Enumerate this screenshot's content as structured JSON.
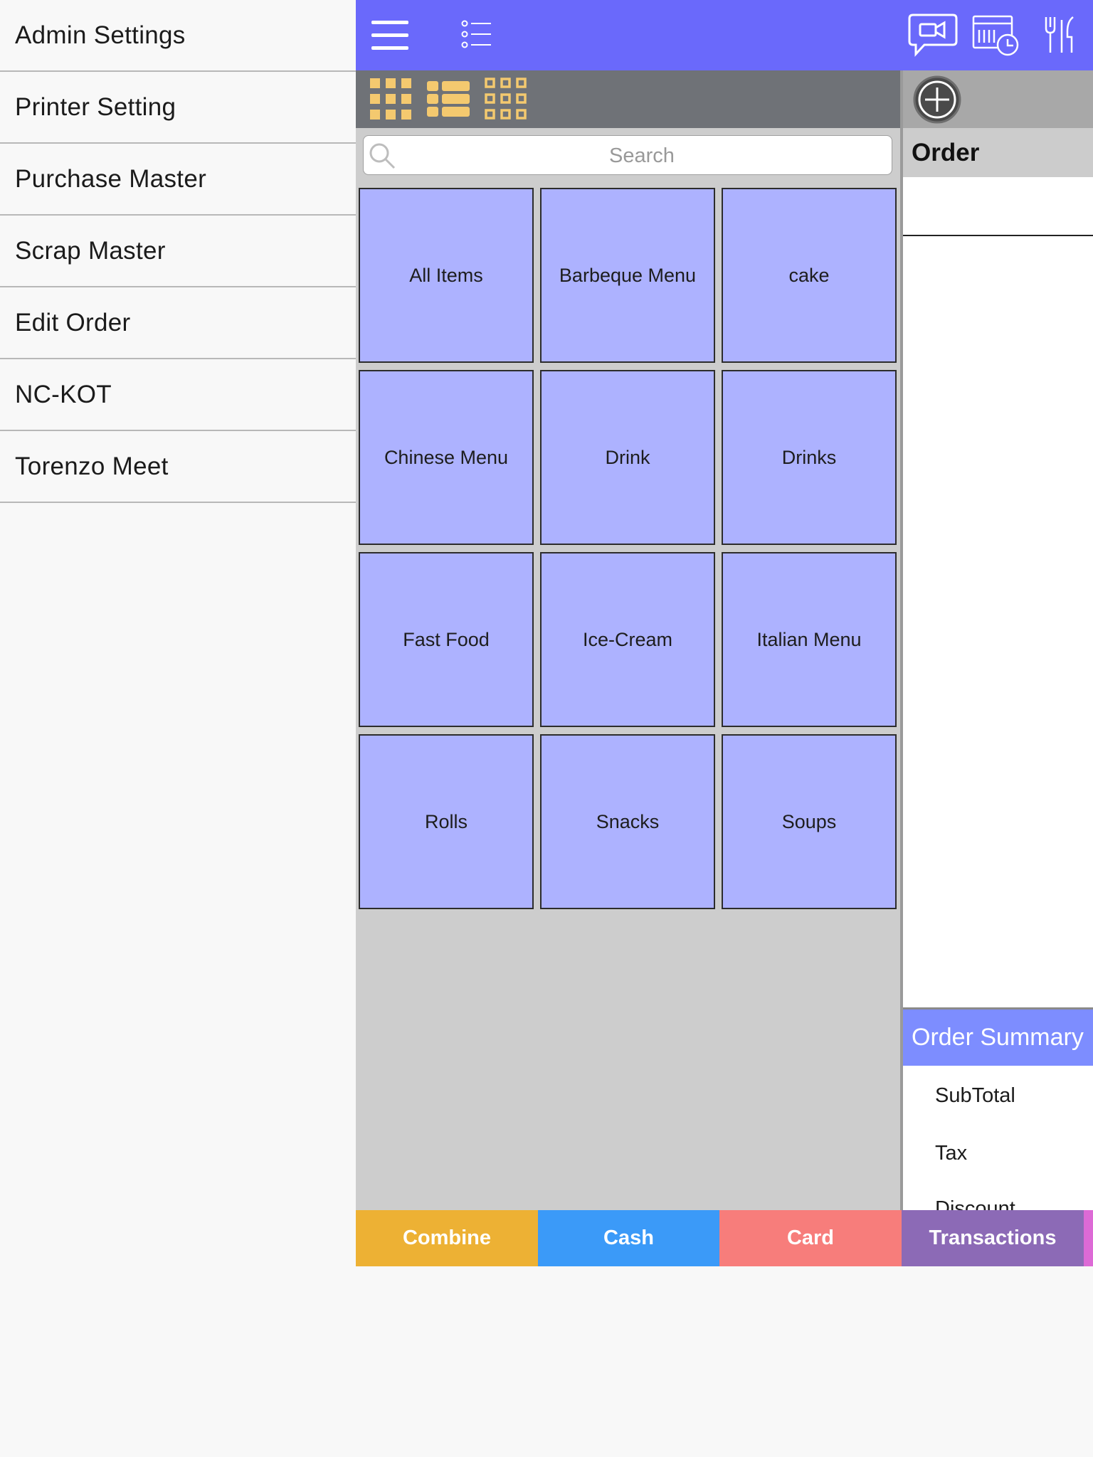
{
  "drawer": {
    "items": [
      {
        "label": "Admin Settings"
      },
      {
        "label": "Printer Setting"
      },
      {
        "label": "Purchase Master"
      },
      {
        "label": "Scrap Master"
      },
      {
        "label": "Edit Order"
      },
      {
        "label": "NC-KOT"
      },
      {
        "label": "Torenzo Meet"
      }
    ]
  },
  "topbar": {
    "color": "#6a69fb",
    "icons": [
      "hamburger-menu-icon",
      "checklist-icon",
      "video-chat-icon",
      "calendar-clock-icon",
      "cutlery-icon"
    ]
  },
  "viewbar": {
    "icons": [
      "grid-view-icon",
      "list-view-icon",
      "outline-grid-view-icon"
    ],
    "icon_color": "#f4c96f"
  },
  "search": {
    "placeholder": "Search"
  },
  "categories": [
    {
      "label": "All Items"
    },
    {
      "label": "Barbeque Menu"
    },
    {
      "label": "cake"
    },
    {
      "label": "Chinese Menu"
    },
    {
      "label": "Drink"
    },
    {
      "label": "Drinks"
    },
    {
      "label": "Fast Food"
    },
    {
      "label": "Ice-Cream"
    },
    {
      "label": "Italian Menu"
    },
    {
      "label": "Rolls"
    },
    {
      "label": "Snacks"
    },
    {
      "label": "Soups"
    }
  ],
  "order": {
    "title": "Order",
    "summary_title": "Order Summary",
    "rows": [
      {
        "label": "SubTotal"
      },
      {
        "label": "Tax"
      },
      {
        "label": "Discount"
      }
    ]
  },
  "actions": [
    {
      "label": "Combine",
      "color": "#edb134"
    },
    {
      "label": "Cash",
      "color": "#3b9af8"
    },
    {
      "label": "Card",
      "color": "#f77d7b"
    },
    {
      "label": "Transactions",
      "color": "#8c6ab6"
    }
  ],
  "colors": {
    "tile": "#adb2ff",
    "summary_header": "#7d8dff",
    "extra_tab": "#dd6ad6"
  }
}
